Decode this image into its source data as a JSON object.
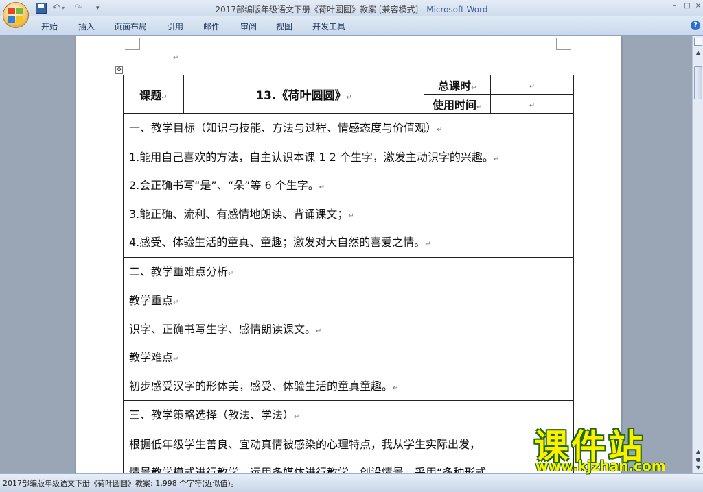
{
  "window": {
    "title": "2017部编版年级语文下册《荷叶圆圆》教案 [兼容模式] - ",
    "app_name": "Microsoft Word",
    "minimize": "–",
    "maximize": "□",
    "close": "×"
  },
  "quick_access": {
    "undo": "↶",
    "undo_dropdown": "▾",
    "redo": "↷",
    "customize": "▾"
  },
  "ribbon": {
    "tabs": [
      "开始",
      "插入",
      "页面布局",
      "引用",
      "邮件",
      "审阅",
      "视图",
      "开发工具"
    ],
    "help": "?"
  },
  "document": {
    "paragraph_mark": "↵",
    "table_handle": "✥",
    "header": {
      "lesson_label": "课题",
      "lesson_title": "13.《荷叶圆圆》",
      "total_hours_label": "总课时",
      "total_hours_value": "",
      "usage_time_label": "使用时间",
      "usage_time_value": ""
    },
    "sections": [
      {
        "heading": "一、教学目标（知识与技能、方法与过程、情感态度与价值观）",
        "paragraphs": [
          "1.能用自己喜欢的方法，自主认识本课 1 2 个生字，激发主动识字的兴趣。",
          "2.会正确书写“是”、“朵”等 6 个生字。",
          "3.能正确、流利、有感情地朗读、背诵课文；",
          "4.感受、体验生活的童真、童趣；激发对大自然的喜爱之情。"
        ]
      },
      {
        "heading": "二、教学重难点分析",
        "paragraphs": [
          "教学重点",
          "识字、正确书写生字、感情朗读课文。",
          "教学难点",
          "初步感受汉字的形体美，感受、体验生活的童真童趣。"
        ]
      },
      {
        "heading": "三、教学策略选择（教法、学法）",
        "paragraphs": [
          "根据低年级学生善良、宜动真情被感染的心理特点，我从学生实际出发，",
          "情景教学模式进行教学，运用多媒体进行教学，创设情景，采用“多种形式"
        ]
      }
    ]
  },
  "status_bar": {
    "text": "2017部编版年级语文下册《荷叶圆圆》教案: 1,998 个字符(近似值)。"
  },
  "scrollbar": {
    "up": "▲",
    "prev": "▲",
    "browse": "●",
    "next": "▼"
  },
  "watermark": {
    "title": "课件站",
    "url": "www.kjzhan.com"
  },
  "colors": {
    "title_app": "#3a5d97",
    "ribbon_text": "#1e395b",
    "watermark_fill": "#ffee00",
    "watermark_outline": "#1a6b14"
  }
}
